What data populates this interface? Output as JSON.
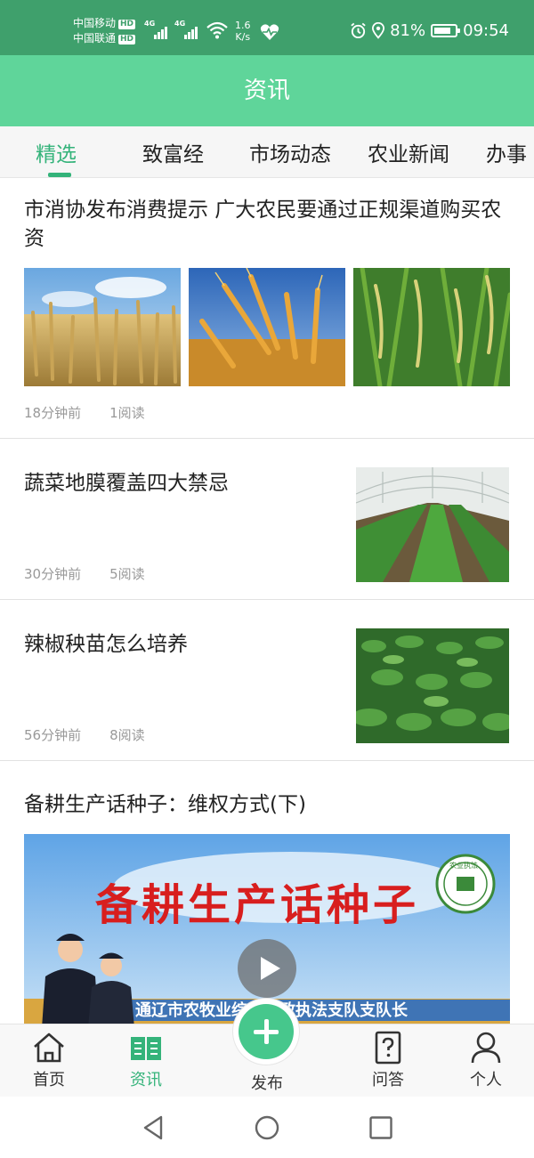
{
  "status_bar": {
    "carrier_1": "中国移动",
    "carrier_2": "中国联通",
    "hd_badge": "HD",
    "network_1": "4G",
    "network_2": "4G",
    "speed_value": "1.6",
    "speed_unit": "K/s",
    "battery": "81%",
    "battery_level": 0.81,
    "time": "09:54"
  },
  "header": {
    "title": "资讯"
  },
  "tabs": [
    {
      "label": "精选",
      "active": true
    },
    {
      "label": "致富经"
    },
    {
      "label": "市场动态"
    },
    {
      "label": "农业新闻"
    },
    {
      "label": "办事"
    }
  ],
  "articles": [
    {
      "title": "市消协发布消费提示 广大农民要通过正规渠道购买农资",
      "time": "18分钟前",
      "reads": "1阅读",
      "images": [
        "wheat-field-image",
        "wheat-ears-sky-image",
        "rice-ears-image"
      ]
    },
    {
      "title": "蔬菜地膜覆盖四大禁忌",
      "time": "30分钟前",
      "reads": "5阅读",
      "image": "greenhouse-vegetables-image"
    },
    {
      "title": "辣椒秧苗怎么培养",
      "time": "56分钟前",
      "reads": "8阅读",
      "image": "pepper-seedlings-image"
    },
    {
      "title": "备耕生产话种子：维权方式(下)",
      "video": {
        "headline": "备耕生产话种子",
        "caption": "通辽市农牧业综合行政执法支队支队长",
        "badge_text": "农业执法"
      }
    }
  ],
  "bottom_nav": [
    {
      "label": "首页",
      "icon": "home-icon"
    },
    {
      "label": "资讯",
      "icon": "book-icon",
      "active": true
    },
    {
      "label": "发布",
      "icon": "plus-icon"
    },
    {
      "label": "问答",
      "icon": "question-icon"
    },
    {
      "label": "个人",
      "icon": "person-icon"
    }
  ],
  "colors": {
    "status_bar": "#3fa06c",
    "app_bar": "#5fd59a",
    "accent": "#34b37a",
    "meta_text": "#999999"
  }
}
